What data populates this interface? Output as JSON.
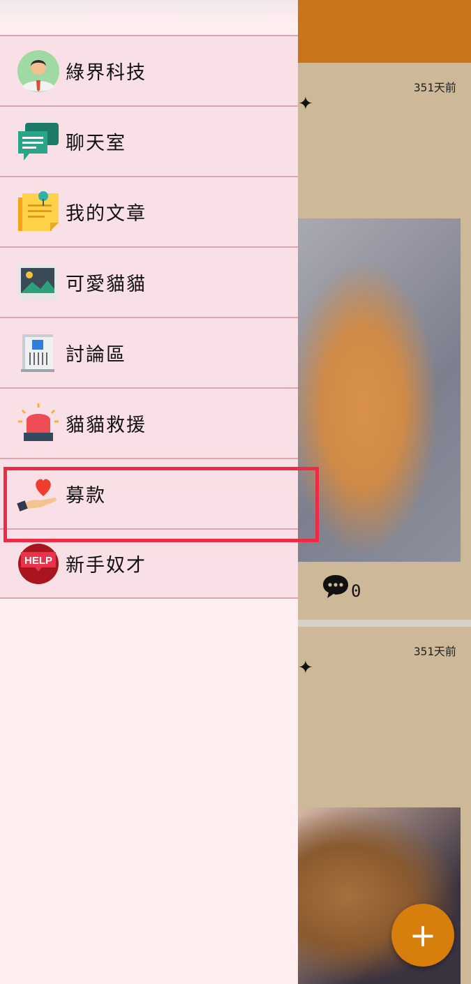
{
  "background_feed": {
    "posts": [
      {
        "time": "351天前",
        "comment_count": "0"
      },
      {
        "time": "351天前"
      }
    ],
    "fab_label": "+"
  },
  "drawer": {
    "items": [
      {
        "label": "綠界科技",
        "icon": "person-avatar-icon"
      },
      {
        "label": "聊天室",
        "icon": "chat-bubble-icon"
      },
      {
        "label": "我的文章",
        "icon": "sticky-note-icon"
      },
      {
        "label": "可愛貓貓",
        "icon": "image-landscape-icon"
      },
      {
        "label": "討論區",
        "icon": "newspaper-icon"
      },
      {
        "label": "貓貓救援",
        "icon": "siren-icon"
      },
      {
        "label": "募款",
        "icon": "heart-hand-icon",
        "highlighted": true
      },
      {
        "label": "新手奴才",
        "icon": "help-badge-icon",
        "badge_text": "HELP"
      }
    ]
  },
  "colors": {
    "appbar": "#c87418",
    "fab": "#d77f0d",
    "highlight": "#ec2c46",
    "drawer_item_bg": "#f8e0e6"
  }
}
